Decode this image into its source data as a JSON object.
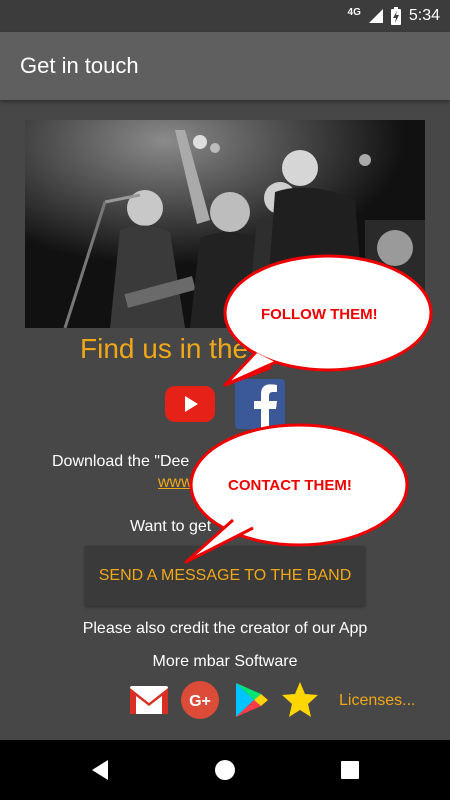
{
  "status_bar": {
    "network": "4G",
    "time": "5:34",
    "icons": [
      "signal-icon",
      "battery-charging-icon"
    ]
  },
  "app_bar": {
    "title": "Get in touch"
  },
  "content": {
    "photo_icon": "band-photo",
    "find_us": "Find us in the",
    "social_icons": [
      "youtube-icon",
      "facebook-icon"
    ],
    "download_text": "Download the \"Dee",
    "website_fragment": "www.",
    "want_text": "Want to get",
    "send_button": "SEND A MESSAGE TO THE BAND",
    "credit_text": "Please also credit the creator of our App",
    "more_text": "More mbar Software",
    "app_icons": [
      "gmail-icon",
      "google-plus-icon",
      "play-store-icon",
      "star-icon"
    ],
    "licenses": "Licenses..."
  },
  "bubbles": {
    "follow": "FOLLOW THEM!",
    "contact": "CONTACT THEM!"
  },
  "nav_bar": {
    "buttons": [
      "back-icon",
      "home-icon",
      "recents-icon"
    ]
  },
  "colors": {
    "accent": "#f0a818",
    "bubble_red": "#e00000",
    "background": "#474747",
    "app_bar": "#5f5f5f"
  }
}
